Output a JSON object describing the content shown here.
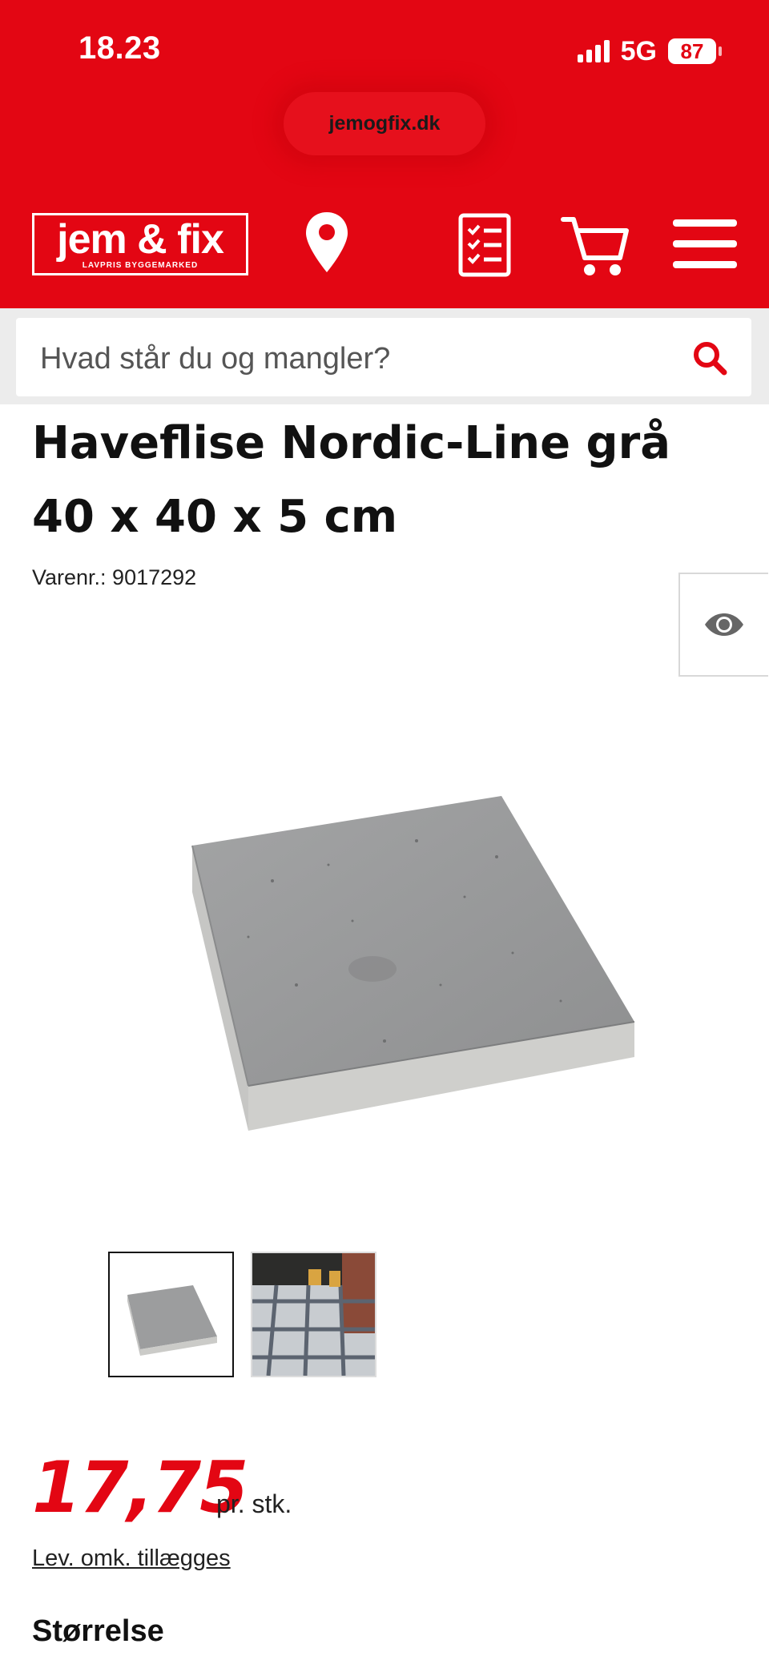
{
  "status_bar": {
    "time": "18.23",
    "network": "5G",
    "battery": "87"
  },
  "browser": {
    "url": "jemogfix.dk"
  },
  "header": {
    "logo_text": "jem & fix",
    "logo_tagline": "LAVPRIS BYGGEMARKED"
  },
  "search": {
    "placeholder": "Hvad står du og mangler?"
  },
  "product": {
    "title": "Haveflise Nordic-Line grå 40 x 40 x 5 cm",
    "sku": "Varenr.: 9017292",
    "price": "17,75",
    "price_unit": "pr. stk.",
    "delivery_link": "Lev. omk. tillægges",
    "size_heading": "Størrelse"
  },
  "colors": {
    "brand_red": "#e30613",
    "tile_gray": "#9a9b9c"
  }
}
